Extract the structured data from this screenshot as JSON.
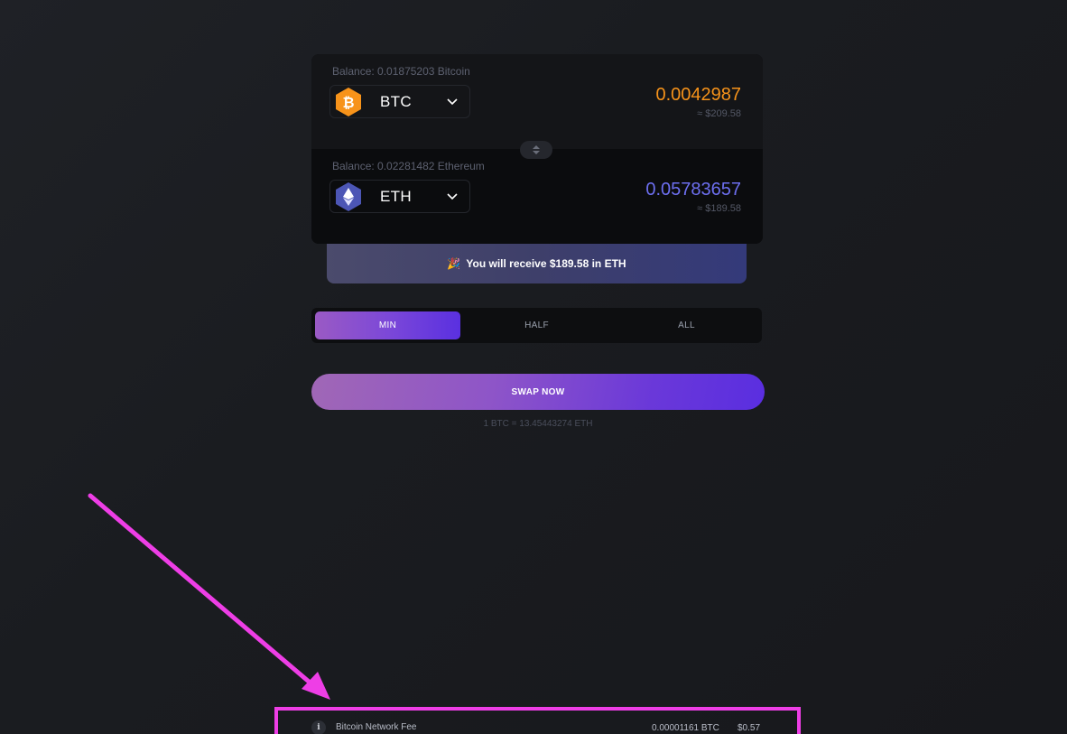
{
  "from": {
    "balance": "Balance: 0.01875203 Bitcoin",
    "symbol": "BTC",
    "amount": "0.0042987",
    "usd": "≈ $209.58",
    "icon": "bitcoin-icon",
    "color": "#f7931a"
  },
  "to": {
    "balance": "Balance: 0.02281482 Ethereum",
    "symbol": "ETH",
    "amount": "0.05783657",
    "usd": "≈ $189.58",
    "icon": "ethereum-icon",
    "color": "#6d6ff0"
  },
  "receive_banner": {
    "emoji": "🎉",
    "text": "You will receive $189.58 in ETH"
  },
  "amount_tabs": [
    {
      "label": "MIN",
      "active": true
    },
    {
      "label": "HALF",
      "active": false
    },
    {
      "label": "ALL",
      "active": false
    }
  ],
  "swap_button": "SWAP NOW",
  "rate": "1 BTC = 13.45443274 ETH",
  "fee": {
    "info_icon": "i",
    "label": "Bitcoin Network Fee",
    "btc": "0.00001161 BTC",
    "usd": "$0.57"
  },
  "annotation": {
    "color": "#ee3ee6"
  }
}
